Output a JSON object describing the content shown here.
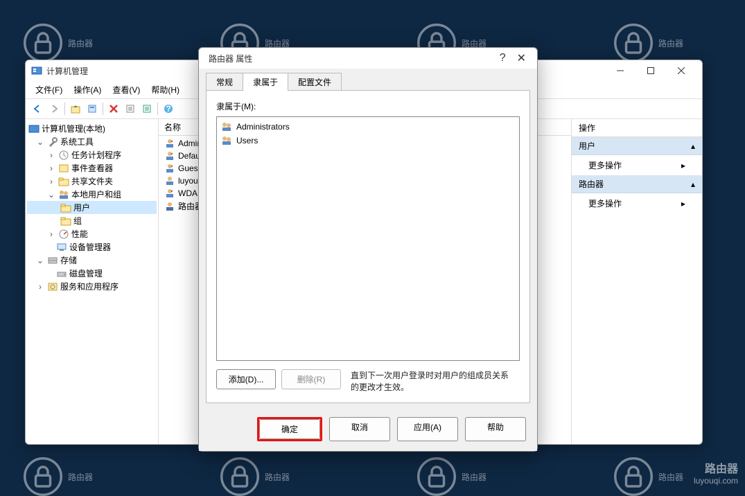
{
  "watermark_text": "路由器",
  "watermark_site": "luyouqi.com",
  "main_window": {
    "title": "计算机管理",
    "menu": [
      "文件(F)",
      "操作(A)",
      "查看(V)",
      "帮助(H)"
    ],
    "tree": {
      "root": "计算机管理(本地)",
      "tools": "系统工具",
      "task": "任务计划程序",
      "event": "事件查看器",
      "share": "共享文件夹",
      "local": "本地用户和组",
      "users": "用户",
      "groups": "组",
      "perf": "性能",
      "devmgr": "设备管理器",
      "storage": "存储",
      "disk": "磁盘管理",
      "services": "服务和应用程序"
    },
    "list_header": "名称",
    "users_list": [
      "Admini",
      "Defau",
      "Gues",
      "luyou",
      "WDA",
      "路由器"
    ],
    "actions": {
      "header": "操作",
      "sec1": "用户",
      "more": "更多操作",
      "sec2": "路由器"
    }
  },
  "dialog": {
    "title": "路由器 属性",
    "tabs": [
      "常规",
      "隶属于",
      "配置文件"
    ],
    "active_tab": 1,
    "label": "隶属于(M):",
    "members": [
      "Administrators",
      "Users"
    ],
    "add": "添加(D)...",
    "remove": "删除(R)",
    "hint": "直到下一次用户登录时对用户的组成员关系的更改才生效。",
    "ok": "确定",
    "cancel": "取消",
    "apply": "应用(A)",
    "help": "帮助"
  }
}
